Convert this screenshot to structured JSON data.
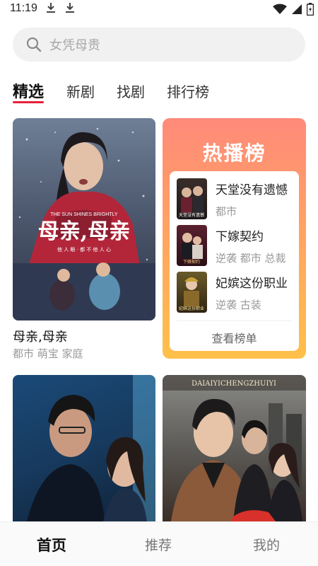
{
  "status_bar": {
    "time": "11:19",
    "icons": [
      "download-icon",
      "download-icon",
      "wifi-icon",
      "signal-icon",
      "battery-icon"
    ]
  },
  "search": {
    "placeholder": "女凭母贵"
  },
  "tabs": [
    {
      "label": "精选",
      "active": true
    },
    {
      "label": "新剧",
      "active": false
    },
    {
      "label": "找剧",
      "active": false
    },
    {
      "label": "排行榜",
      "active": false
    }
  ],
  "featured": {
    "poster_text": {
      "title": "母亲,母亲",
      "subtitle_en": "THE SUN SHINES BRIGHTLY",
      "tagline": "他 人 眼 · 都 不 他 人 心"
    },
    "title": "母亲,母亲",
    "tags": "都市 萌宝 家庭"
  },
  "hot_list": {
    "title": "热播榜",
    "items": [
      {
        "name": "天堂没有遗憾",
        "tags": "都市",
        "thumb_text": "天堂没有遗憾"
      },
      {
        "name": "下嫁契约",
        "tags": "逆袭 都市 总裁",
        "thumb_text": "下嫁契约"
      },
      {
        "name": "妃嫔这份职业",
        "tags": "逆袭 古装",
        "thumb_text": "妃嫔这份职业"
      }
    ],
    "more_label": "查看榜单"
  },
  "second_row": {
    "right_poster_text": "DAIAIYICHENGZHUIYI"
  },
  "bottom_nav": [
    {
      "label": "首页",
      "active": true
    },
    {
      "label": "推荐",
      "active": false
    },
    {
      "label": "我的",
      "active": false
    }
  ],
  "colors": {
    "accent": "#e8203c",
    "hot_gradient_top": "#ff8a7a",
    "hot_gradient_bottom": "#ffc04a"
  }
}
